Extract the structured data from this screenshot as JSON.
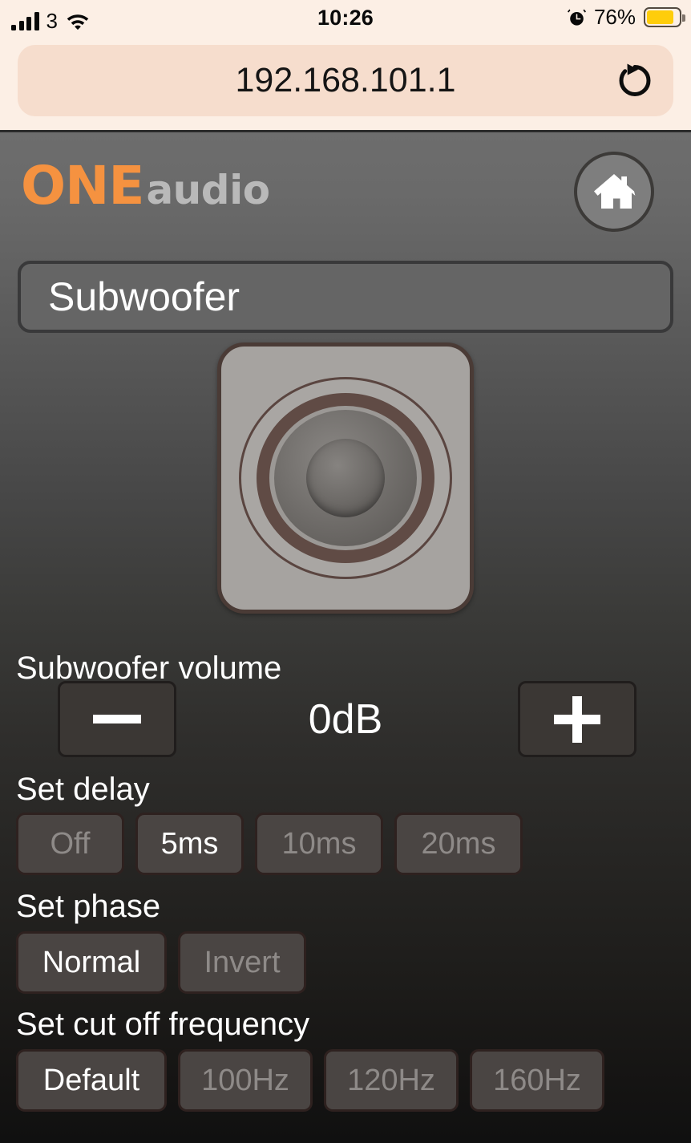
{
  "status_bar": {
    "signal_icon": "cellular-signal-icon",
    "carrier": "3",
    "wifi_icon": "wifi-icon",
    "time": "10:26",
    "alarm_icon": "alarm-clock-icon",
    "battery_percent": "76%",
    "battery_level": 76,
    "battery_fill_color": "#ffcc00"
  },
  "browser": {
    "url": "192.168.101.1",
    "reload_icon": "reload-icon"
  },
  "app": {
    "brand": {
      "primary": "ONE",
      "secondary": "audio",
      "primary_color": "#f59240",
      "secondary_color": "#b9b9b9"
    },
    "home_button_icon": "home-icon",
    "page_title": "Subwoofer",
    "speaker_icon": "subwoofer-speaker-icon",
    "volume": {
      "label": "Subwoofer volume",
      "decrease_icon": "minus-icon",
      "increase_icon": "plus-icon",
      "value": "0dB"
    },
    "delay": {
      "label": "Set delay",
      "options": [
        {
          "label": "Off",
          "selected": false
        },
        {
          "label": "5ms",
          "selected": true
        },
        {
          "label": "10ms",
          "selected": false
        },
        {
          "label": "20ms",
          "selected": false
        }
      ]
    },
    "phase": {
      "label": "Set phase",
      "options": [
        {
          "label": "Normal",
          "selected": true
        },
        {
          "label": "Invert",
          "selected": false
        }
      ]
    },
    "cutoff": {
      "label": "Set cut off frequency",
      "options": [
        {
          "label": "Default",
          "selected": true
        },
        {
          "label": "100Hz",
          "selected": false
        },
        {
          "label": "120Hz",
          "selected": false
        },
        {
          "label": "160Hz",
          "selected": false
        }
      ]
    }
  }
}
